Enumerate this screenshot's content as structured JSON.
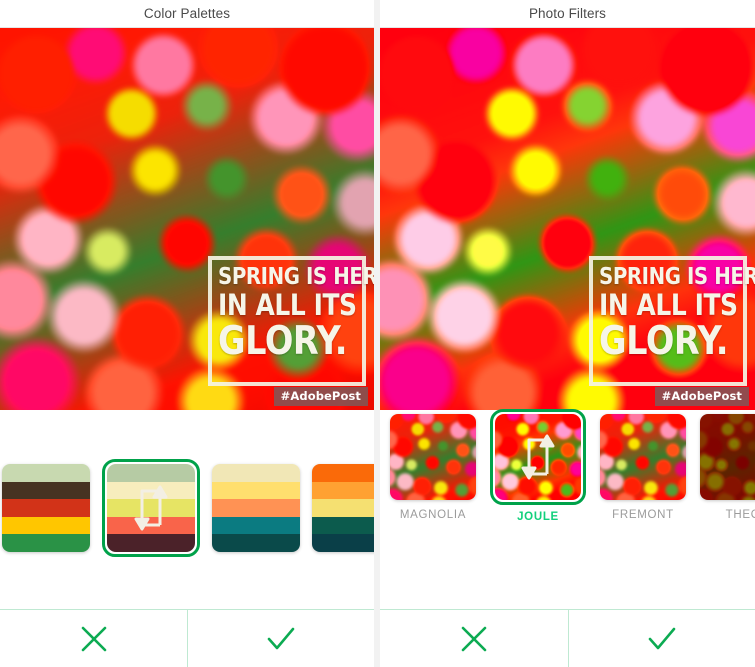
{
  "app": {
    "accent_green": "#00a24a",
    "selected_label_green": "#12d07c",
    "divider_green": "#bfe9d2"
  },
  "panels": [
    {
      "id": "color-palettes",
      "title": "Color Palettes",
      "photo": {
        "overlay": {
          "line1": "SPRING IS HERE",
          "line2": "IN ALL ITS",
          "line3": "GLORY.",
          "watermark": "#AdobePost"
        }
      },
      "palettes": [
        {
          "name": "palette-1",
          "selected": false,
          "colors": [
            "#c8d9b0",
            "#463322",
            "#d23318",
            "#ffc600",
            "#2a9246"
          ]
        },
        {
          "name": "palette-2",
          "selected": true,
          "icon": "shuffle-icon",
          "colors": [
            "#b6cba4",
            "#f7edbd",
            "#e6e464",
            "#f9644a",
            "#4b2229"
          ]
        },
        {
          "name": "palette-3",
          "selected": false,
          "colors": [
            "#f1e7b6",
            "#ffdf6e",
            "#ff9254",
            "#0b7b81",
            "#0a4a4a"
          ]
        },
        {
          "name": "palette-4",
          "selected": false,
          "colors": [
            "#fa6a09",
            "#ffa132",
            "#f5e071",
            "#0c5b4d",
            "#0a3f48"
          ]
        }
      ],
      "actions": [
        {
          "name": "cancel-button",
          "icon": "x-icon"
        },
        {
          "name": "confirm-button",
          "icon": "check-icon"
        }
      ]
    },
    {
      "id": "photo-filters",
      "title": "Photo Filters",
      "photo": {
        "overlay": {
          "line1": "SPRING IS HERE",
          "line2": "IN ALL ITS",
          "line3": "GLORY.",
          "watermark": "#AdobePost"
        }
      },
      "filters": [
        {
          "label": "MAGNOLIA",
          "selected": false,
          "style": "normal"
        },
        {
          "label": "JOULE",
          "selected": true,
          "style": "vivid",
          "icon": "shuffle-icon"
        },
        {
          "label": "FREMONT",
          "selected": false,
          "style": "normal"
        },
        {
          "label": "THEO",
          "selected": false,
          "style": "sepia-dark"
        }
      ],
      "actions": [
        {
          "name": "cancel-button",
          "icon": "x-icon"
        },
        {
          "name": "confirm-button",
          "icon": "check-icon"
        }
      ]
    }
  ]
}
